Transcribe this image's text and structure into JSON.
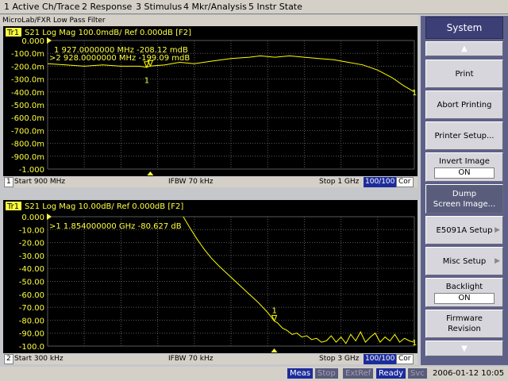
{
  "menu": [
    "1 Active Ch/Trace",
    "2 Response",
    "3 Stimulus",
    "4 Mkr/Analysis",
    "5 Instr State"
  ],
  "window_title": "MicroLab/FXR Low Pass Filter",
  "panel1": {
    "trace_tag": "Tr1",
    "header": "S21 Log Mag 100.0mdB/ Ref 0.000dB [F2]",
    "y_labels": [
      "0.000",
      "-100.0m",
      "-200.0m",
      "-300.0m",
      "-400.0m",
      "-500.0m",
      "-600.0m",
      "-700.0m",
      "-800.0m",
      "-900.0m",
      "-1.000"
    ],
    "y_range": [
      -1.0,
      0.0
    ],
    "y_units": "dB",
    "x_range": [
      900,
      1000
    ],
    "x_units": "MHz",
    "markers": [
      {
        "label": "1",
        "text": "1  927.0000000 MHz -208.12 mdB",
        "x": 927,
        "y": -0.20812,
        "active": false
      },
      {
        "label": "2",
        "text": ">2  928.0000000 MHz -199.09 mdB",
        "x": 928,
        "y": -0.19909,
        "active": true
      }
    ],
    "end_marker_label": "1",
    "trace": [
      [
        900,
        -0.18
      ],
      [
        905,
        -0.19
      ],
      [
        910,
        -0.2
      ],
      [
        915,
        -0.19
      ],
      [
        920,
        -0.2
      ],
      [
        925,
        -0.2
      ],
      [
        927,
        -0.208
      ],
      [
        928,
        -0.199
      ],
      [
        932,
        -0.19
      ],
      [
        936,
        -0.17
      ],
      [
        940,
        -0.18
      ],
      [
        945,
        -0.16
      ],
      [
        950,
        -0.14
      ],
      [
        955,
        -0.13
      ],
      [
        958,
        -0.12
      ],
      [
        962,
        -0.13
      ],
      [
        966,
        -0.12
      ],
      [
        970,
        -0.13
      ],
      [
        974,
        -0.14
      ],
      [
        978,
        -0.15
      ],
      [
        982,
        -0.17
      ],
      [
        986,
        -0.19
      ],
      [
        990,
        -0.23
      ],
      [
        994,
        -0.29
      ],
      [
        997,
        -0.35
      ],
      [
        1000,
        -0.4
      ]
    ],
    "status": {
      "start": "Start 900 MHz",
      "ifbw": "IFBW 70 kHz",
      "stop": "Stop 1 GHz",
      "avg": "100/100",
      "cor": "Cor",
      "ch": "1"
    }
  },
  "panel2": {
    "trace_tag": "Tr1",
    "header": "S21 Log Mag 10.00dB/ Ref 0.000dB [F2]",
    "y_labels": [
      "0.000",
      "-10.00",
      "-20.00",
      "-30.00",
      "-40.00",
      "-50.00",
      "-60.00",
      "-70.00",
      "-80.00",
      "-90.00",
      "-100.0"
    ],
    "y_range": [
      -100.0,
      0.0
    ],
    "y_units": "dB",
    "x_range": [
      0.0003,
      3.0
    ],
    "x_units": "GHz",
    "markers": [
      {
        "label": "1",
        "text": ">1  1.854000000 GHz -80.627 dB",
        "x": 1.854,
        "y": -80.627,
        "active": true
      }
    ],
    "end_marker_label": "1",
    "trace": [
      [
        1.11,
        0.0
      ],
      [
        1.16,
        -8
      ],
      [
        1.22,
        -17
      ],
      [
        1.28,
        -25
      ],
      [
        1.34,
        -32
      ],
      [
        1.4,
        -38
      ],
      [
        1.48,
        -45
      ],
      [
        1.56,
        -52
      ],
      [
        1.64,
        -59
      ],
      [
        1.72,
        -66
      ],
      [
        1.8,
        -74
      ],
      [
        1.854,
        -80.627
      ],
      [
        1.88,
        -82
      ],
      [
        1.92,
        -86
      ],
      [
        1.96,
        -88
      ],
      [
        2.0,
        -91
      ],
      [
        2.04,
        -90
      ],
      [
        2.08,
        -93
      ],
      [
        2.12,
        -92
      ],
      [
        2.16,
        -95
      ],
      [
        2.2,
        -94
      ],
      [
        2.24,
        -97
      ],
      [
        2.28,
        -96
      ],
      [
        2.32,
        -92
      ],
      [
        2.36,
        -97
      ],
      [
        2.4,
        -93
      ],
      [
        2.44,
        -98
      ],
      [
        2.48,
        -91
      ],
      [
        2.52,
        -96
      ],
      [
        2.56,
        -89
      ],
      [
        2.6,
        -97
      ],
      [
        2.64,
        -93
      ],
      [
        2.68,
        -90
      ],
      [
        2.72,
        -97
      ],
      [
        2.76,
        -93
      ],
      [
        2.8,
        -96
      ],
      [
        2.84,
        -91
      ],
      [
        2.88,
        -97
      ],
      [
        2.92,
        -94
      ],
      [
        2.96,
        -96
      ],
      [
        3.0,
        -97
      ]
    ],
    "status": {
      "start": "Start 300 kHz",
      "ifbw": "IFBW 70 kHz",
      "stop": "Stop 3 GHz",
      "avg": "100/100",
      "cor": "Cor",
      "ch": "2"
    }
  },
  "softkeys": {
    "title": "System",
    "items": [
      {
        "label": "Print"
      },
      {
        "label": "Abort Printing"
      },
      {
        "label": "Printer Setup..."
      },
      {
        "label": "Invert Image",
        "value": "ON"
      },
      {
        "label": "Dump\nScreen Image...",
        "dark": true
      },
      {
        "label": "E5091A Setup",
        "arrow": true
      },
      {
        "label": "Misc Setup",
        "arrow": true
      },
      {
        "label": "Backlight",
        "value": "ON"
      },
      {
        "label": "Firmware\nRevision"
      }
    ]
  },
  "bottom": {
    "meas": "Meas",
    "stop": "Stop",
    "extref": "ExtRef",
    "ready": "Ready",
    "svc": "Svc",
    "datetime": "2006-01-12 10:05"
  },
  "colors": {
    "trace": "#ffff00",
    "grid": "#5a5a5a",
    "text": "#ffff40",
    "bg": "#000000"
  }
}
